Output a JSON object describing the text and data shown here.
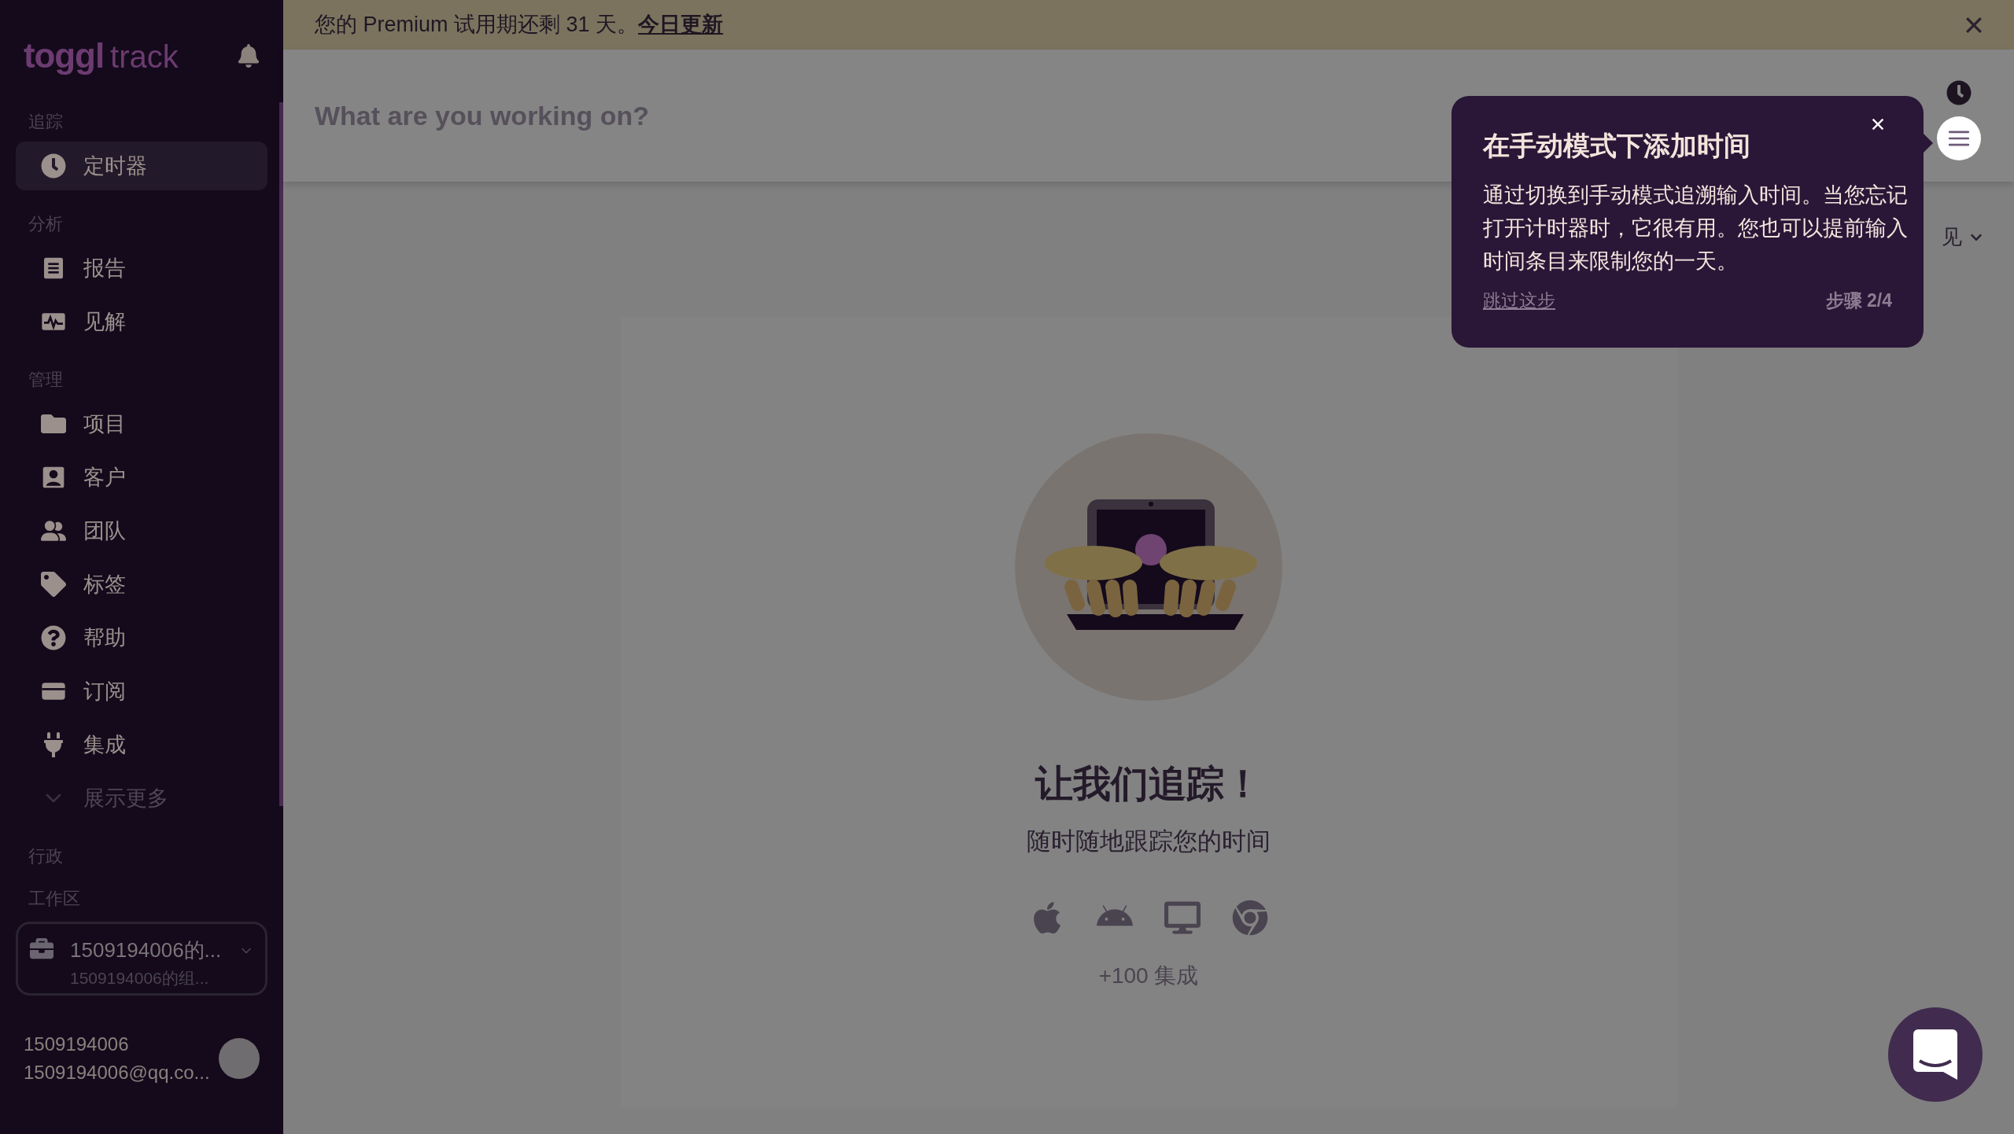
{
  "sidebar": {
    "logo": {
      "brand": "toggl",
      "product": "track"
    },
    "sections": [
      {
        "label": "追踪",
        "items": [
          {
            "label": "定时器",
            "selected": true,
            "kind": "link"
          }
        ]
      },
      {
        "label": "分析",
        "items": [
          {
            "label": "报告",
            "selected": false,
            "kind": "link"
          },
          {
            "label": "见解",
            "selected": false,
            "kind": "link"
          }
        ]
      },
      {
        "label": "管理",
        "items": [
          {
            "label": "项目",
            "selected": false,
            "kind": "link"
          },
          {
            "label": "客户",
            "selected": false,
            "kind": "link"
          },
          {
            "label": "团队",
            "selected": false,
            "kind": "link"
          },
          {
            "label": "标签",
            "selected": false,
            "kind": "link"
          },
          {
            "label": "帮助",
            "selected": false,
            "kind": "link"
          },
          {
            "label": "订阅",
            "selected": false,
            "kind": "link"
          },
          {
            "label": "集成",
            "selected": false,
            "kind": "link"
          },
          {
            "label": "展示更多",
            "selected": false,
            "kind": "expander"
          }
        ]
      },
      {
        "label": "行政"
      }
    ],
    "workspace": {
      "label": "工作区",
      "name": "1509194006的...",
      "organization": "1509194006的组..."
    },
    "profile": {
      "name": "1509194006",
      "email": "1509194006@qq.co..."
    }
  },
  "banner": {
    "text": "您的 Premium 试用期还剩 31 天。",
    "link": "今日更新"
  },
  "timer": {
    "placeholder": "What are you working on?",
    "view_selector": "见"
  },
  "empty_state": {
    "title": "让我们追踪！",
    "subtitle": "随时随地跟踪您的时间",
    "integrations": "+100 集成"
  },
  "tooltip": {
    "title": "在手动模式下添加时间",
    "body": "通过切换到手动模式追溯输入时间。当您忘记打开计时器时，它很有用。您也可以提前输入时间条目来限制您的一天。",
    "skip": "跳过这步",
    "step": "步骤 2/4"
  }
}
